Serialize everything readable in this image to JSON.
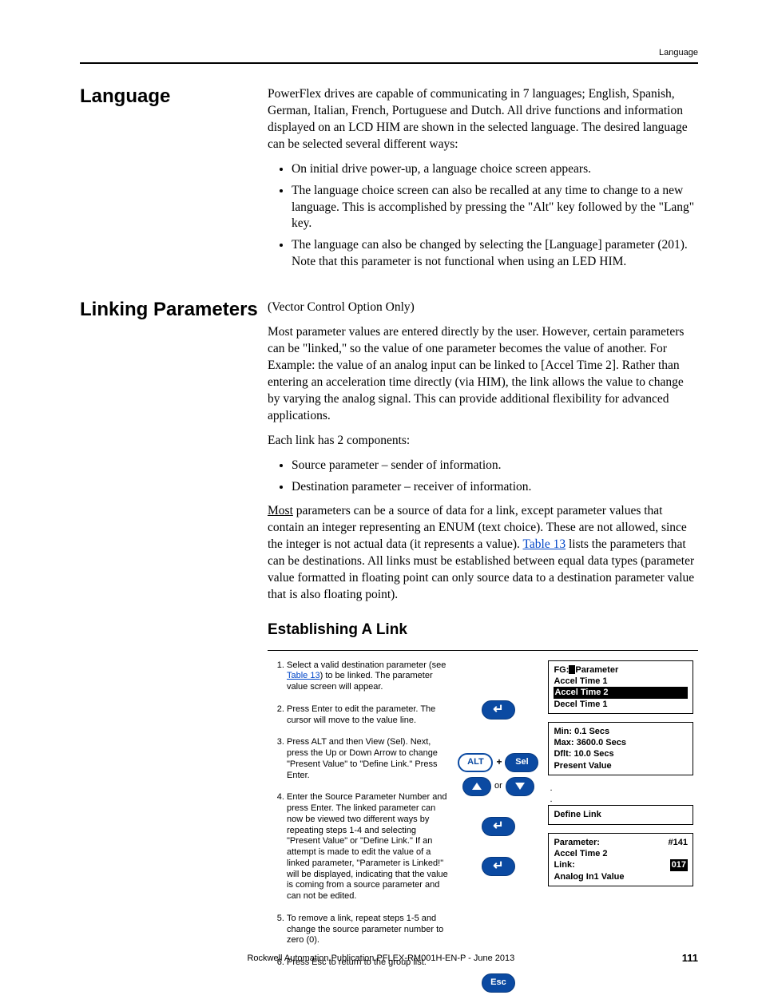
{
  "header": {
    "label": "Language"
  },
  "sections": {
    "language": {
      "title": "Language",
      "intro": "PowerFlex drives are capable of communicating in 7 languages; English, Spanish, German, Italian, French, Portuguese and Dutch. All drive functions and information displayed on an LCD HIM are shown in the selected language. The desired language can be selected several different ways:",
      "bullets": [
        "On initial drive power-up, a language choice screen appears.",
        "The language choice screen can also be recalled at any time to change to a new language. This is accomplished by pressing the \"Alt\" key followed by the \"Lang\" key.",
        "The language can also be changed by selecting the [Language] parameter (201). Note that this parameter is not functional when using an LED HIM."
      ]
    },
    "linking": {
      "title": "Linking Parameters",
      "note": "(Vector Control Option Only)",
      "p1": "Most parameter values are entered directly by the user. However, certain parameters can be \"linked,\" so the value of one parameter becomes the value of another. For Example: the value of an analog input can be linked to [Accel Time 2]. Rather than entering an acceleration time directly (via HIM), the link allows the value to change by varying the analog signal. This can provide additional flexibility for advanced applications.",
      "p2": "Each link has 2 components:",
      "bullets": [
        "Source parameter – sender of information.",
        "Destination parameter – receiver of information."
      ],
      "p3_a": "Most",
      "p3_b": " parameters can be a source of data for a link, except parameter values that contain an integer representing an ENUM (text choice). These are not allowed, since the integer is not actual data (it represents a value). ",
      "p3_link": "Table 13",
      "p3_c": " lists the parameters that can be destinations. All links must be established between equal data types (parameter value formatted in floating point can only source data to a destination parameter value that is also floating point).",
      "subhead": "Establishing A Link",
      "steps": {
        "s1_a": "Select a valid destination parameter (see ",
        "s1_link": "Table 13",
        "s1_b": ") to be linked. The parameter value screen will appear.",
        "s2": "Press Enter to edit the parameter. The cursor will move to the value line.",
        "s3": "Press ALT and then View (Sel). Next, press the Up or Down Arrow to change \"Present Value\" to \"Define Link.\" Press Enter.",
        "s4": "Enter the Source Parameter Number and press Enter. The linked parameter can now be viewed two different ways by repeating steps 1-4 and selecting \"Present Value\" or \"Define Link.\" If an attempt is made to edit the value of a linked parameter, \"Parameter is Linked!\" will be displayed, indicating that the value is coming from a source parameter and can not be edited.",
        "s5": "To remove a link, repeat steps 1-5 and change the source parameter number to zero (0).",
        "s6": "Press Esc to return to the group list."
      },
      "buttons": {
        "alt": "ALT",
        "sel": "Sel",
        "or": "or",
        "esc": "Esc"
      },
      "him": {
        "box1": {
          "title_a": "FG:",
          "title_b": "Parameter",
          "l1": "Accel Time 1",
          "sel": "Accel Time 2",
          "l3": "Decel Time 1"
        },
        "box2": {
          "min": "Min: 0.1 Secs",
          "max": "Max: 3600.0 Secs",
          "dflt": "Dflt: 10.0 Secs",
          "pv": "Present Value"
        },
        "box3": {
          "label": "Define Link"
        },
        "box4": {
          "l1a": "Parameter:",
          "l1b": "#141",
          "l2": "Accel Time 2",
          "l3a": "Link:",
          "l3b": "017",
          "l4": "Analog In1 Value"
        }
      }
    }
  },
  "footer": {
    "text": "Rockwell Automation Publication PFLEX-RM001H-EN-P - June 2013",
    "page": "111"
  }
}
